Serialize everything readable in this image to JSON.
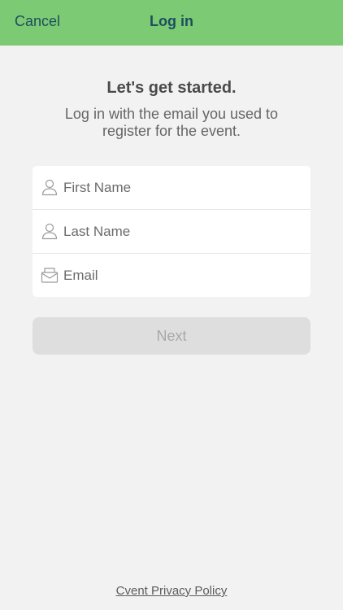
{
  "navbar": {
    "cancel_label": "Cancel",
    "title": "Log in",
    "background_color": "#7dca75",
    "text_color": "#1d4f5c"
  },
  "intro": {
    "heading": "Let's get started.",
    "subheading": "Log in with the email you used to register for the event."
  },
  "form": {
    "first_name": {
      "placeholder": "First Name",
      "value": "",
      "icon": "person-icon"
    },
    "last_name": {
      "placeholder": "Last Name",
      "value": "",
      "icon": "person-icon"
    },
    "email": {
      "placeholder": "Email",
      "value": "",
      "icon": "envelope-icon"
    }
  },
  "next_button": {
    "label": "Next",
    "state": "disabled"
  },
  "footer": {
    "privacy_link": "Cvent Privacy Policy"
  }
}
